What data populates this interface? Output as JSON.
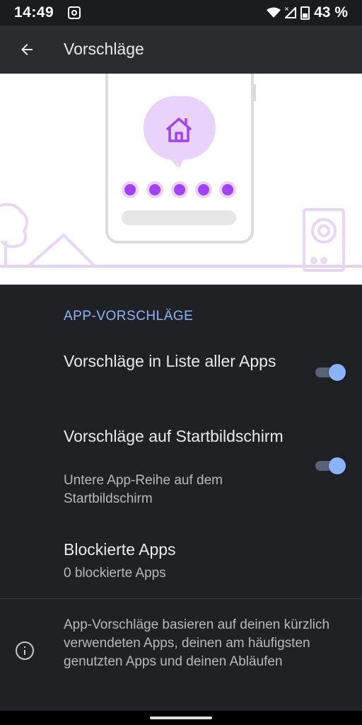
{
  "status_bar": {
    "time": "14:49",
    "battery": "43 %"
  },
  "app_bar": {
    "title": "Vorschläge"
  },
  "section": {
    "header": "APP-VORSCHLÄGE"
  },
  "settings": {
    "all_apps_list": {
      "title": "Vorschläge in Liste aller Apps",
      "enabled": true
    },
    "home_screen": {
      "title": "Vorschläge auf Startbildschirm",
      "summary": "Untere App-Reihe auf dem Startbildschirm",
      "enabled": true
    },
    "blocked_apps": {
      "title": "Blockierte Apps",
      "summary": "0 blockierte Apps"
    }
  },
  "footer": {
    "info_text": "App-Vorschläge basieren auf deinen kürzlich verwendeten Apps, deinen am häufigsten genutzten Apps und deinen Abläufen"
  },
  "colors": {
    "accent": "#8ab4f8",
    "illustration_purple": "#a142f4",
    "illustration_light_purple": "#e9d3fb",
    "background": "#202125"
  },
  "icons": {
    "back": "arrow-left-icon",
    "info": "info-icon",
    "home": "home-icon",
    "wifi": "wifi-icon",
    "signal": "signal-icon",
    "battery": "battery-icon",
    "instagram": "instagram-icon"
  }
}
